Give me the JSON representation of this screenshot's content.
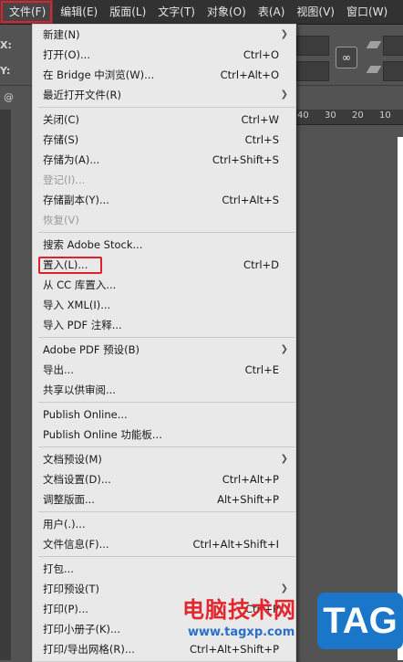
{
  "menubar": {
    "items": [
      {
        "label": "文件(F)",
        "active": true
      },
      {
        "label": "编辑(E)"
      },
      {
        "label": "版面(L)"
      },
      {
        "label": "文字(T)"
      },
      {
        "label": "对象(O)"
      },
      {
        "label": "表(A)"
      },
      {
        "label": "视图(V)"
      },
      {
        "label": "窗口(W)"
      }
    ]
  },
  "background": {
    "x_label": "X:",
    "y_label": "Y:",
    "ruler_ticks": [
      "40",
      "30",
      "20",
      "10"
    ],
    "tab_fragment": "@"
  },
  "file_menu": {
    "groups": [
      [
        {
          "label": "新建(N)",
          "submenu": true
        },
        {
          "label": "打开(O)...",
          "shortcut": "Ctrl+O"
        },
        {
          "label": "在 Bridge 中浏览(W)...",
          "shortcut": "Ctrl+Alt+O"
        },
        {
          "label": "最近打开文件(R)",
          "submenu": true
        }
      ],
      [
        {
          "label": "关闭(C)",
          "shortcut": "Ctrl+W"
        },
        {
          "label": "存储(S)",
          "shortcut": "Ctrl+S"
        },
        {
          "label": "存储为(A)...",
          "shortcut": "Ctrl+Shift+S"
        },
        {
          "label": "登记(I)...",
          "disabled": true
        },
        {
          "label": "存储副本(Y)...",
          "shortcut": "Ctrl+Alt+S"
        },
        {
          "label": "恢复(V)",
          "disabled": true
        }
      ],
      [
        {
          "label": "搜索 Adobe Stock..."
        },
        {
          "label": "置入(L)...",
          "shortcut": "Ctrl+D",
          "highlight": true
        },
        {
          "label": "从 CC 库置入..."
        },
        {
          "label": "导入 XML(I)..."
        },
        {
          "label": "导入 PDF 注释..."
        }
      ],
      [
        {
          "label": "Adobe PDF 预设(B)",
          "submenu": true
        },
        {
          "label": "导出...",
          "shortcut": "Ctrl+E"
        },
        {
          "label": "共享以供审阅..."
        }
      ],
      [
        {
          "label": "Publish Online..."
        },
        {
          "label": "Publish Online 功能板..."
        }
      ],
      [
        {
          "label": "文档预设(M)",
          "submenu": true
        },
        {
          "label": "文档设置(D)...",
          "shortcut": "Ctrl+Alt+P"
        },
        {
          "label": "调整版面...",
          "shortcut": "Alt+Shift+P"
        }
      ],
      [
        {
          "label": "用户(.)..."
        },
        {
          "label": "文件信息(F)...",
          "shortcut": "Ctrl+Alt+Shift+I"
        }
      ],
      [
        {
          "label": "打包..."
        },
        {
          "label": "打印预设(T)",
          "submenu": true
        },
        {
          "label": "打印(P)...",
          "shortcut": "Ctrl+P"
        },
        {
          "label": "打印小册子(K)..."
        },
        {
          "label": "打印/导出网格(R)...",
          "shortcut": "Ctrl+Alt+Shift+P"
        }
      ]
    ]
  },
  "watermark": {
    "title": "电脑技术网",
    "url": "www.tagxp.com",
    "badge": "TAG"
  },
  "colors": {
    "menubar_bg": "#323232",
    "menu_bg": "#e9e9e9",
    "highlight_red": "#e0202a",
    "watermark_blue": "#1a76c9"
  }
}
